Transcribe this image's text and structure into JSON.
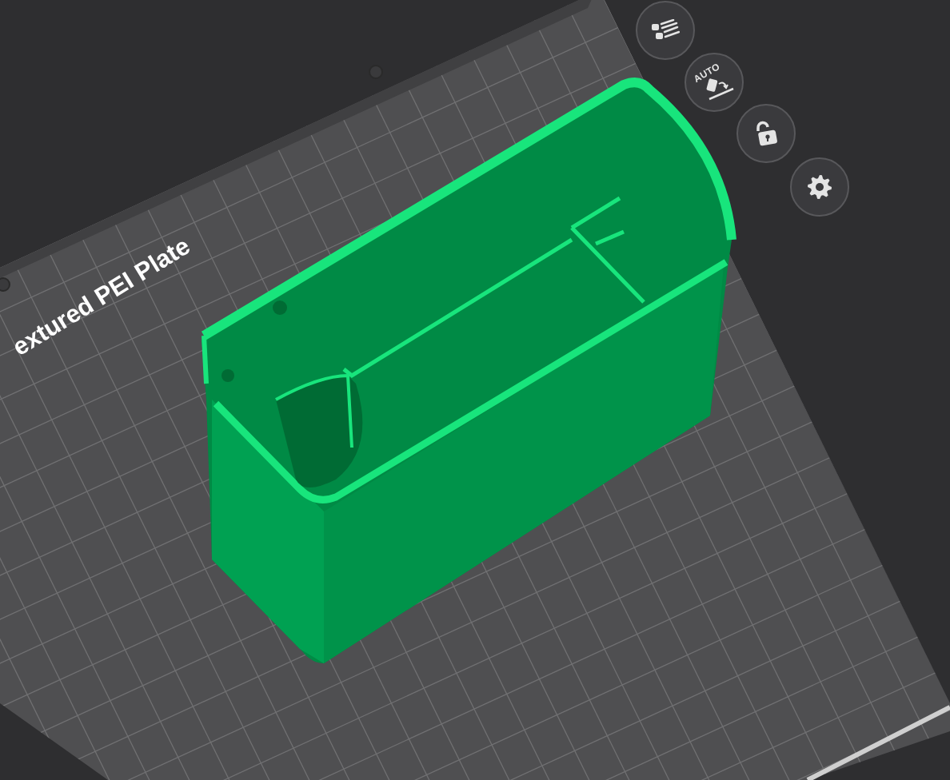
{
  "plate": {
    "label": "extured PEI Plate"
  },
  "toolbar": [
    {
      "kind": "arrange"
    },
    {
      "kind": "auto-orient",
      "text": "AUTO"
    },
    {
      "kind": "lock"
    },
    {
      "kind": "settings"
    }
  ]
}
